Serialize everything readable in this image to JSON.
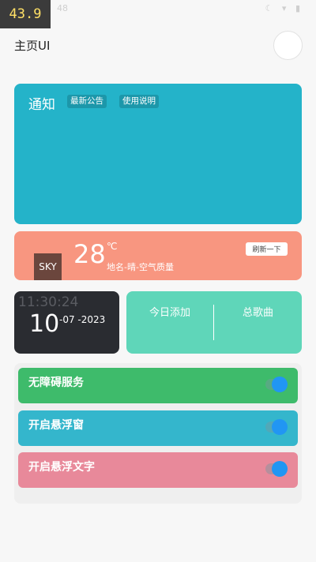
{
  "overlay": {
    "fps": "43.9"
  },
  "status_bar": {
    "left": "48",
    "icons": "☾ ▾ ▮"
  },
  "header": {
    "title": "主页UI"
  },
  "notice": {
    "title": "通知",
    "chips": [
      "最新公告",
      "使用说明"
    ]
  },
  "weather": {
    "sky": "SKY",
    "temperature": "28",
    "unit": "℃",
    "description": "地名-晴-空气质量",
    "refresh_label": "刷新一下"
  },
  "clock": {
    "time": "11:30:24",
    "day": "10",
    "month_year": "-07 -2023"
  },
  "stats": {
    "today_label": "今日添加",
    "total_label": "总歌曲"
  },
  "switches": [
    {
      "label": "无障碍服务",
      "color": "#3ebb6b"
    },
    {
      "label": "开启悬浮窗",
      "color": "#34b6cc"
    },
    {
      "label": "开启悬浮文字",
      "color": "#e8899a"
    }
  ],
  "colors": {
    "accent_toggle": "#2196f3",
    "notice_bg": "#24b3c9",
    "weather_bg": "#f89680"
  }
}
